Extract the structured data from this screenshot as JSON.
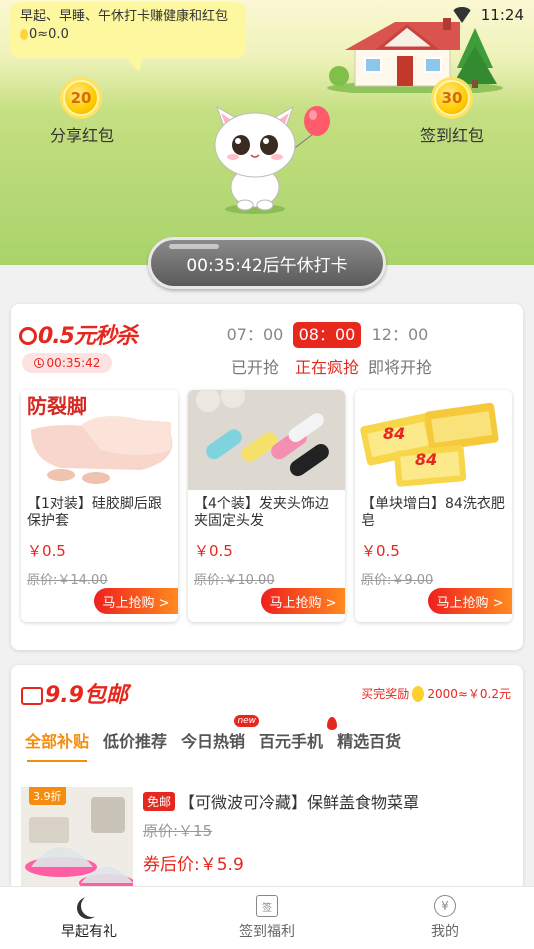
{
  "status_bar": {
    "time": "11:24"
  },
  "hero": {
    "bubble_text": "早起、早睡、午休打卡赚健康和红包",
    "bubble_value": "0≈0.0",
    "left_coin": {
      "value": "20",
      "label": "分享红包"
    },
    "right_coin": {
      "value": "30",
      "label": "签到红包"
    },
    "timer_text": "00:35:42后午休打卡"
  },
  "flash_sale": {
    "logo_text": "0.5元秒杀",
    "countdown": "00:35:42",
    "slots": [
      {
        "time": "07：00",
        "status": "已开抢"
      },
      {
        "time": "08：00",
        "status": "正在疯抢",
        "active": true
      },
      {
        "time": "12：00",
        "status": "即将开抢"
      }
    ],
    "products": [
      {
        "title": "【1对装】硅胶脚后跟保护套",
        "price": "￥0.5",
        "orig": "原价:￥14.00",
        "cta": "马上抢购 >",
        "image_text": "防裂脚"
      },
      {
        "title": "【4个装】发夹头饰边夹固定头发",
        "price": "￥0.5",
        "orig": "原价:￥10.00",
        "cta": "马上抢购 >"
      },
      {
        "title": "【单块增白】84洗衣肥皂",
        "price": "￥0.5",
        "orig": "原价:￥9.00",
        "cta": "马上抢购 >",
        "image_text": "84"
      }
    ]
  },
  "nine_nine": {
    "logo_text": "9.9包邮",
    "reward_text": "买完奖励",
    "reward_value": "2000≈￥0.2元",
    "tabs": [
      {
        "label": "全部补贴",
        "active": true
      },
      {
        "label": "低价推荐"
      },
      {
        "label": "今日热销",
        "badge": "new"
      },
      {
        "label": "百元手机",
        "flame": true
      },
      {
        "label": "精选百货"
      }
    ],
    "deal": {
      "discount": "3.9折",
      "free_tag": "免邮",
      "title": "【可微波可冷藏】保鲜盖食物菜罩",
      "orig": "原价:￥15",
      "price": "券后价:￥5.9"
    }
  },
  "bottom_nav": [
    {
      "label": "早起有礼",
      "icon": "moon-icon",
      "active": true
    },
    {
      "label": "签到福利",
      "icon": "calendar-icon",
      "icon_text": "签"
    },
    {
      "label": "我的",
      "icon": "yen-icon",
      "icon_text": "¥"
    }
  ],
  "colors": {
    "accent": "#e6271e",
    "orange": "#f58c0d",
    "grass": "#a9d36a"
  }
}
